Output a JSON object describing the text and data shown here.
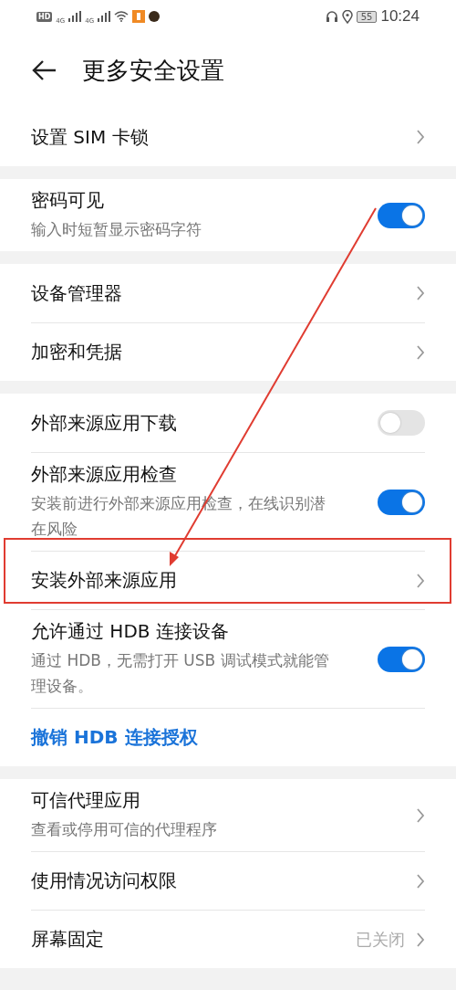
{
  "status_bar": {
    "hd": "HD",
    "networks": [
      "4G",
      "4G"
    ],
    "battery": "55",
    "time": "10:24"
  },
  "header": {
    "title": "更多安全设置"
  },
  "groups": [
    {
      "rows": [
        {
          "kind": "chevron",
          "title": "设置 SIM 卡锁"
        }
      ]
    },
    {
      "rows": [
        {
          "kind": "toggle",
          "title": "密码可见",
          "subtitle": "输入时短暂显示密码字符",
          "on": true
        }
      ]
    },
    {
      "rows": [
        {
          "kind": "chevron",
          "title": "设备管理器"
        },
        {
          "kind": "chevron",
          "title": "加密和凭据"
        }
      ]
    },
    {
      "rows": [
        {
          "kind": "toggle",
          "title": "外部来源应用下载",
          "on": false
        },
        {
          "kind": "toggle",
          "title": "外部来源应用检查",
          "subtitle": "安装前进行外部来源应用检查，在线识别潜在风险",
          "on": true
        },
        {
          "kind": "chevron",
          "title": "安装外部来源应用"
        },
        {
          "kind": "toggle",
          "title": "允许通过 HDB 连接设备",
          "subtitle": "通过 HDB，无需打开 USB 调试模式就能管理设备。",
          "on": true
        },
        {
          "kind": "link",
          "title": "撤销 HDB 连接授权"
        }
      ]
    },
    {
      "rows": [
        {
          "kind": "chevron",
          "title": "可信代理应用",
          "subtitle": "查看或停用可信的代理程序"
        },
        {
          "kind": "chevron",
          "title": "使用情况访问权限"
        },
        {
          "kind": "value",
          "title": "屏幕固定",
          "value": "已关闭"
        }
      ]
    }
  ]
}
